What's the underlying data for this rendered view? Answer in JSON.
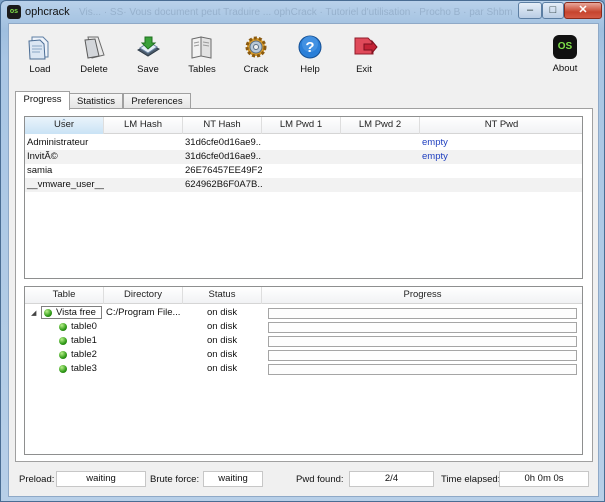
{
  "window": {
    "title": "ophcrack",
    "faded_background_text": "Vis... · SS· Vous document peut Traduire ... ophCrack · Tutoriel d'utilisation · Procho B · par Shbm",
    "app_icon": "os-logo-icon"
  },
  "toolbar": {
    "load": "Load",
    "delete": "Delete",
    "save": "Save",
    "tables": "Tables",
    "crack": "Crack",
    "help": "Help",
    "exit": "Exit",
    "about": "About",
    "about_logo": "OS"
  },
  "tabs": [
    "Progress",
    "Statistics",
    "Preferences"
  ],
  "hash_table": {
    "columns": [
      "User",
      "LM Hash",
      "NT Hash",
      "LM Pwd 1",
      "LM Pwd 2",
      "NT Pwd"
    ],
    "rows": [
      {
        "user": "Administrateur",
        "lm_hash": "",
        "nt_hash": "31d6cfe0d16ae9...",
        "lm_pwd1": "",
        "lm_pwd2": "",
        "nt_pwd": "empty"
      },
      {
        "user": "InvitÃ©",
        "lm_hash": "",
        "nt_hash": "31d6cfe0d16ae9...",
        "lm_pwd1": "",
        "lm_pwd2": "",
        "nt_pwd": "empty"
      },
      {
        "user": "samia",
        "lm_hash": "",
        "nt_hash": "26E76457EE49F2...",
        "lm_pwd1": "",
        "lm_pwd2": "",
        "nt_pwd": ""
      },
      {
        "user": "__vmware_user__",
        "lm_hash": "",
        "nt_hash": "624962B6F0A7B...",
        "lm_pwd1": "",
        "lm_pwd2": "",
        "nt_pwd": ""
      }
    ]
  },
  "tables_grid": {
    "columns": [
      "Table",
      "Directory",
      "Status",
      "Progress"
    ],
    "root": {
      "name": "Vista free",
      "directory": "C:/Program File...",
      "status": "on disk",
      "progress": 0
    },
    "children": [
      {
        "name": "table0",
        "status": "on disk",
        "progress": 0
      },
      {
        "name": "table1",
        "status": "on disk",
        "progress": 0
      },
      {
        "name": "table2",
        "status": "on disk",
        "progress": 0
      },
      {
        "name": "table3",
        "status": "on disk",
        "progress": 0
      }
    ]
  },
  "statusbar": {
    "preload_label": "Preload:",
    "preload_value": "waiting",
    "brute_label": "Brute force:",
    "brute_value": "waiting",
    "pwd_found_label": "Pwd found:",
    "pwd_found_value": "2/4",
    "time_label": "Time elapsed:",
    "time_value": "0h 0m 0s"
  },
  "colors": {
    "empty_password": "#1f3fbf",
    "loaded_table": "#2f9a17"
  }
}
